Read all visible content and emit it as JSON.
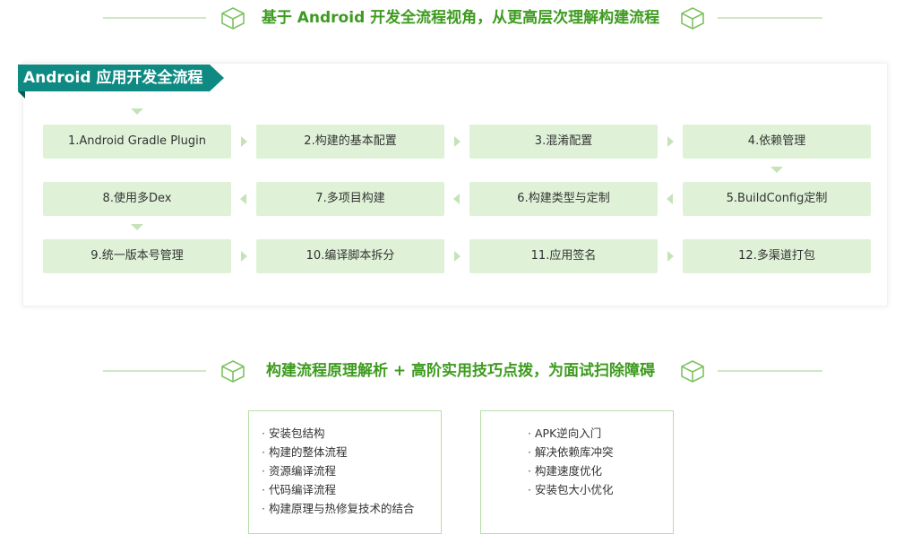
{
  "top_heading": {
    "text": "基于 Android 开发全流程视角，从更高层次理解构建流程"
  },
  "flow": {
    "ribbon_title": "Android 应用开发全流程",
    "steps": [
      "1.Android Gradle Plugin",
      "2.构建的基本配置",
      "3.混淆配置",
      "4.依赖管理",
      "5.BuildConfig定制",
      "6.构建类型与定制",
      "7.多项目构建",
      "8.使用多Dex",
      "9.统一版本号管理",
      "10.编译脚本拆分",
      "11.应用签名",
      "12.多渠道打包"
    ]
  },
  "second_heading": {
    "text": "构建流程原理解析 + 高阶实用技巧点拨，为面试扫除障碍"
  },
  "tips_left": [
    "安装包结构",
    "构建的整体流程",
    "资源编译流程",
    "代码编译流程",
    "构建原理与热修复技术的结合"
  ],
  "tips_right": [
    "APK逆向入门",
    "解决依赖库冲突",
    "构建速度优化",
    "安装包大小优化"
  ],
  "bullet_char": "·",
  "colors": {
    "accent": "#3e9b1f",
    "ribbon": "#0f8a83",
    "step_bg": "#dff2d7",
    "line": "#cfe8c4",
    "box_border": "#b7dea6"
  }
}
